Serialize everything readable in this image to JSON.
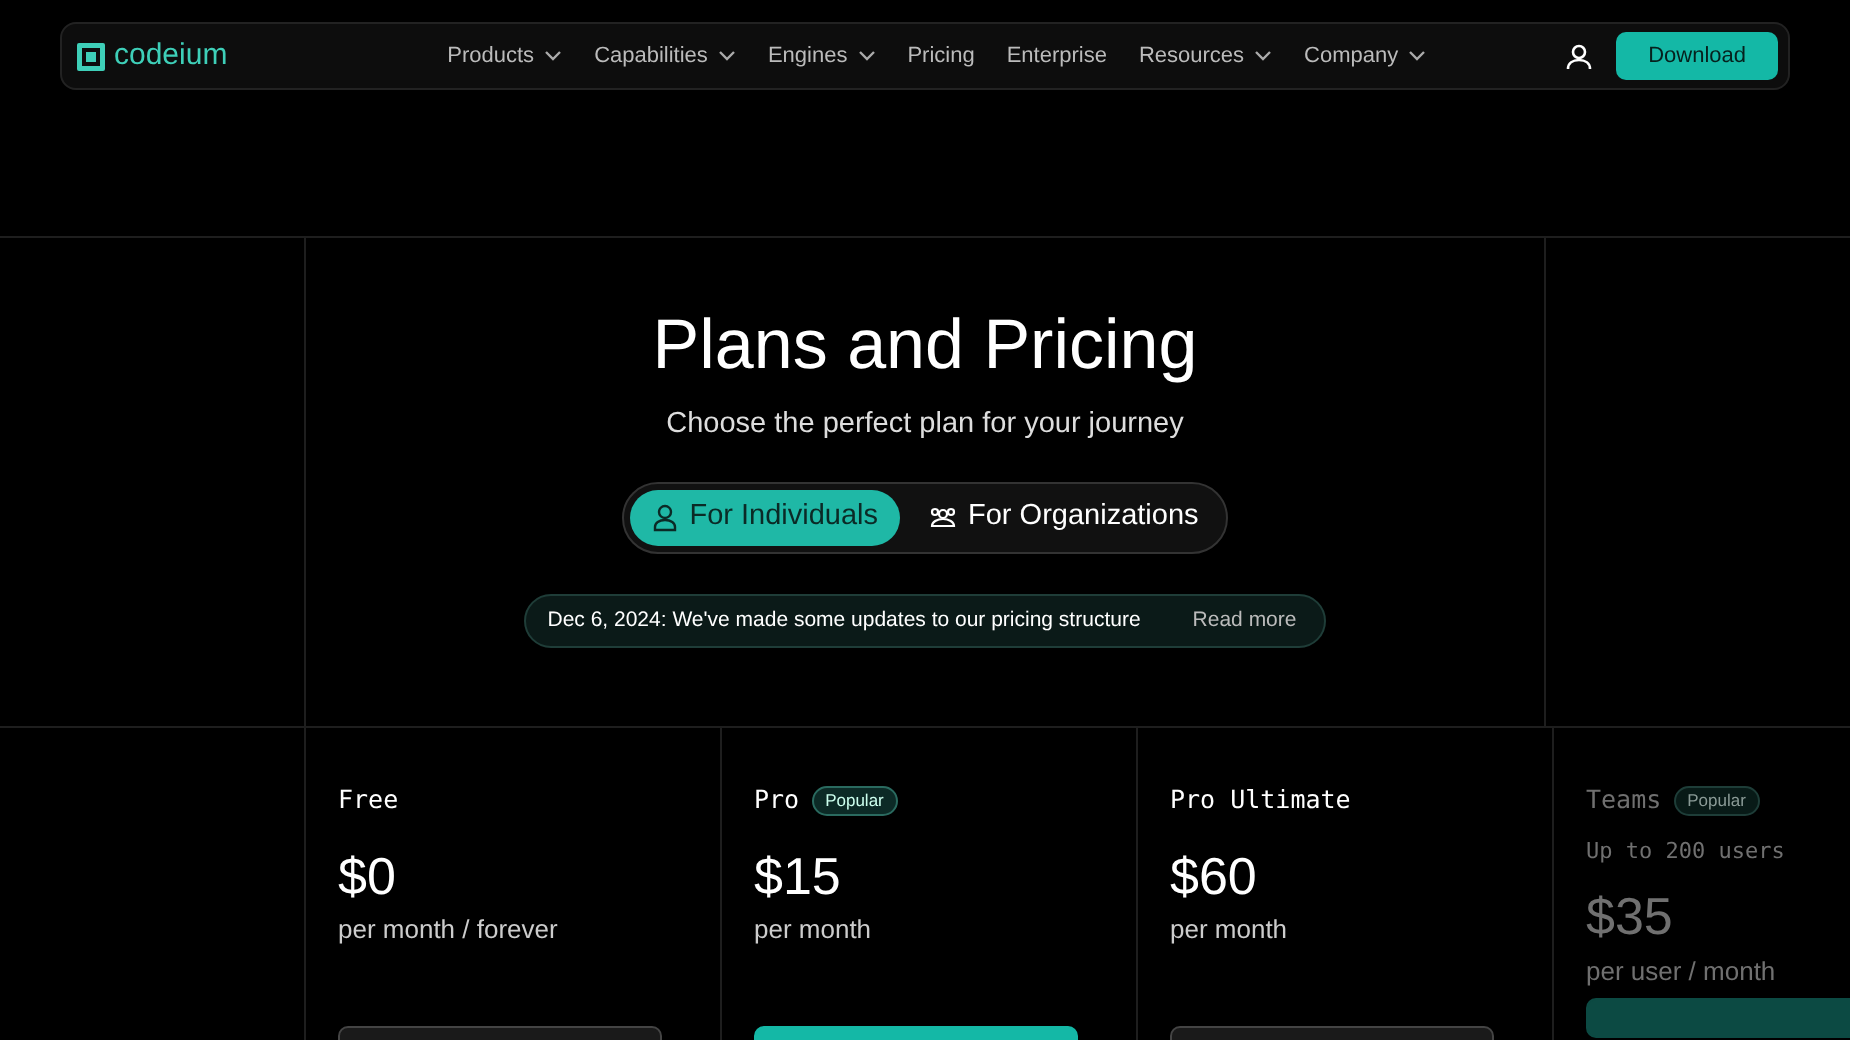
{
  "navbar": {
    "logo": "codeium",
    "menu": [
      {
        "label": "Products",
        "dropdown": true
      },
      {
        "label": "Capabilities",
        "dropdown": true
      },
      {
        "label": "Engines",
        "dropdown": true
      },
      {
        "label": "Pricing",
        "dropdown": false
      },
      {
        "label": "Enterprise",
        "dropdown": false
      },
      {
        "label": "Resources",
        "dropdown": true
      },
      {
        "label": "Company",
        "dropdown": true
      }
    ],
    "download": "Download"
  },
  "hero": {
    "title": "Plans and Pricing",
    "subtitle": "Choose the perfect plan for your journey",
    "tabs": [
      {
        "label": "For Individuals",
        "kind": "person",
        "selected": true
      },
      {
        "label": "For Organizations",
        "kind": "group",
        "selected": false
      }
    ],
    "notice": {
      "text": "Dec 6, 2024: We've made some updates to our pricing structure",
      "link": "Read more"
    }
  },
  "plans": [
    {
      "name": "Free",
      "price": "$0",
      "period": "per month / forever",
      "primary_button": false,
      "dimmed": false
    },
    {
      "name": "Pro",
      "badge": "Popular",
      "price": "$15",
      "period": "per month",
      "primary_button": true,
      "dimmed": false
    },
    {
      "name": "Pro Ultimate",
      "price": "$60",
      "period": "per month",
      "primary_button": false,
      "dimmed": false
    },
    {
      "name": "Teams",
      "badge": "Popular",
      "note": "Up to 200 users",
      "price": "$35",
      "period": "per user / month",
      "primary_button": true,
      "dimmed": true
    }
  ]
}
